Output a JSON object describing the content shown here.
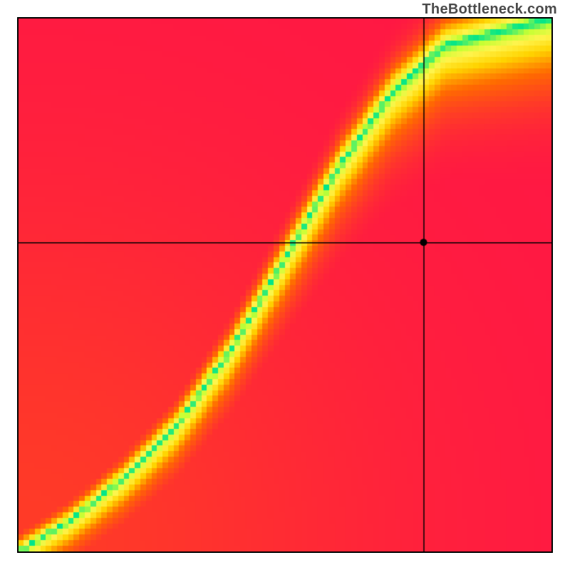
{
  "attribution": "TheBottleneck.com",
  "chart_data": {
    "type": "heatmap",
    "title": "",
    "xlabel": "",
    "ylabel": "",
    "xlim": [
      0,
      1
    ],
    "ylim": [
      0,
      1
    ],
    "crosshair": {
      "x": 0.76,
      "y": 0.58
    },
    "ridge": {
      "description": "optimal match band (green) running from lower-left corner to upper-right, curving upward",
      "points": [
        {
          "x": 0.0,
          "y": 0.0
        },
        {
          "x": 0.1,
          "y": 0.06
        },
        {
          "x": 0.2,
          "y": 0.14
        },
        {
          "x": 0.3,
          "y": 0.24
        },
        {
          "x": 0.4,
          "y": 0.38
        },
        {
          "x": 0.5,
          "y": 0.55
        },
        {
          "x": 0.6,
          "y": 0.72
        },
        {
          "x": 0.7,
          "y": 0.86
        },
        {
          "x": 0.8,
          "y": 0.95
        },
        {
          "x": 1.0,
          "y": 1.0
        }
      ],
      "width_fraction": 0.06
    },
    "colorscale": [
      {
        "t": 0.0,
        "color": "#ff1744"
      },
      {
        "t": 0.35,
        "color": "#ff6a00"
      },
      {
        "t": 0.6,
        "color": "#ffd400"
      },
      {
        "t": 0.8,
        "color": "#fff44d"
      },
      {
        "t": 0.92,
        "color": "#c6ff33"
      },
      {
        "t": 1.0,
        "color": "#00e58a"
      }
    ],
    "pixelation": 96
  }
}
